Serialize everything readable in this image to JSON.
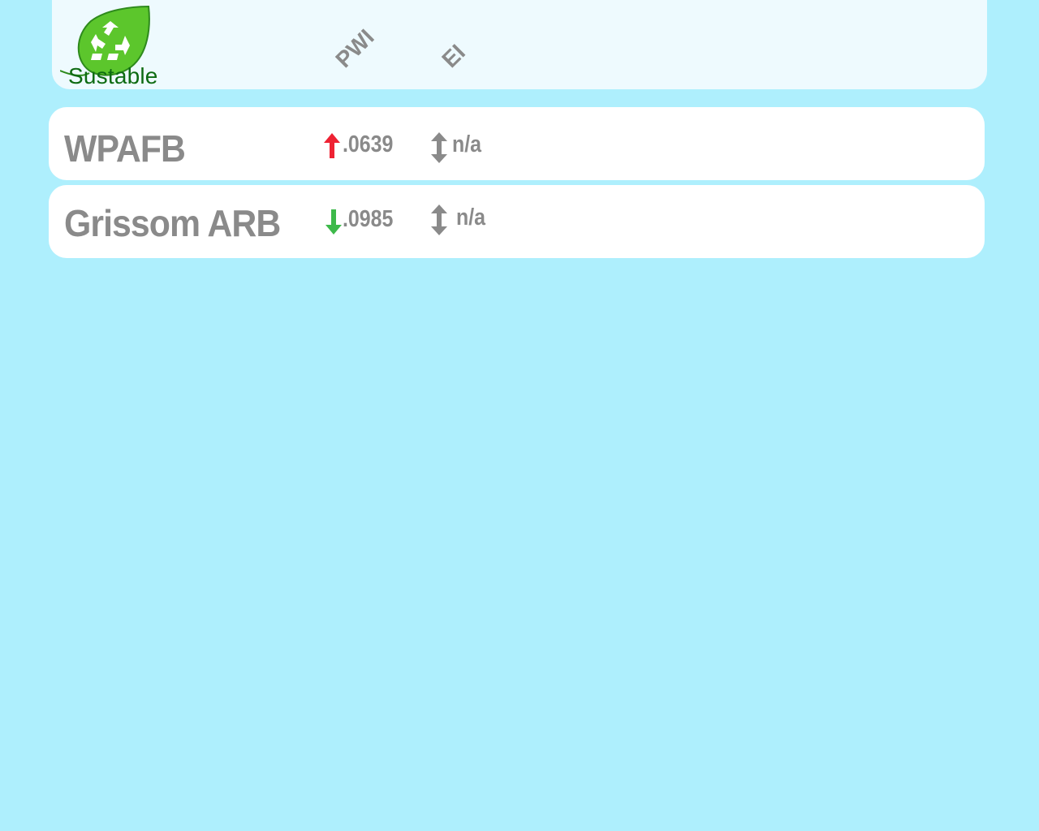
{
  "app": {
    "brand_name": "Sustable",
    "logo_icon": "recycle-leaf-icon"
  },
  "header": {
    "columns": [
      {
        "label": "PWI"
      },
      {
        "label": "EI"
      }
    ]
  },
  "rows": [
    {
      "name": "WPAFB",
      "pwi": {
        "value": ".0639",
        "trend": "up",
        "trend_icon": "arrow-up-icon",
        "trend_color": "#ee2233"
      },
      "ei": {
        "value": "n/a",
        "trend": "neutral",
        "trend_icon": "arrow-up-down-icon",
        "trend_color": "#8a8a8a"
      }
    },
    {
      "name": "Grissom ARB",
      "pwi": {
        "value": ".0985",
        "trend": "down",
        "trend_icon": "arrow-down-icon",
        "trend_color": "#3db94a"
      },
      "ei": {
        "value": "n/a",
        "trend": "neutral",
        "trend_icon": "arrow-up-down-icon",
        "trend_color": "#8a8a8a"
      }
    }
  ],
  "colors": {
    "background": "#aeeffd",
    "header_panel": "#eefafe",
    "row_panel": "#ffffff",
    "text_gray": "#8a8a8a",
    "brand_green": "#0e6b12",
    "leaf_green": "#5cc62c"
  }
}
